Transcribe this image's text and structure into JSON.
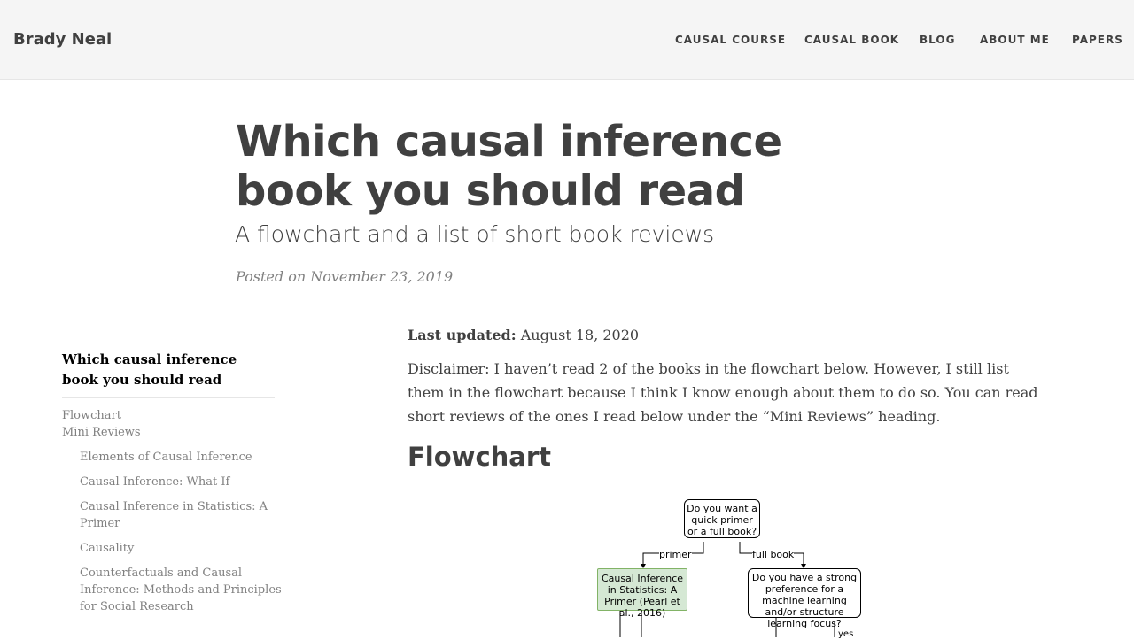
{
  "nav": {
    "brand": "Brady Neal",
    "links": [
      "CAUSAL COURSE",
      "CAUSAL BOOK",
      "BLOG",
      "ABOUT ME",
      "PAPERS"
    ]
  },
  "header": {
    "title": "Which causal inference book you should read",
    "subtitle": "A flowchart and a list of short book reviews",
    "posted": "Posted on November 23, 2019"
  },
  "toc": {
    "title": "Which causal inference book you should read",
    "items": {
      "flowchart": "Flowchart",
      "mini_reviews": "Mini Reviews",
      "sub": [
        "Elements of Causal Inference",
        "Causal Inference: What If",
        "Causal Inference in Statistics: A Primer",
        "Causality",
        "Counterfactuals and Causal Inference: Methods and Principles for Social Research"
      ]
    }
  },
  "content": {
    "updated_label": "Last updated:",
    "updated_date": " August 18, 2020",
    "disclaimer": "Disclaimer: I haven’t read 2 of the books in the flowchart below. However, I still list them in the flowchart because I think I know enough about them to do so. You can read short reviews of the ones I read below under the “Mini Reviews” heading.",
    "flowchart_heading": "Flowchart"
  },
  "flowchart": {
    "start": "Do you want a quick primer or a full book?",
    "edge_primer": "primer",
    "edge_full": "full book",
    "primer_book": "Causal Inference in Statistics: A Primer (Pearl et al., 2016)",
    "ml_question": "Do you have a strong preference for a machine learning and/or structure learning focus?",
    "edge_yes": "yes"
  }
}
